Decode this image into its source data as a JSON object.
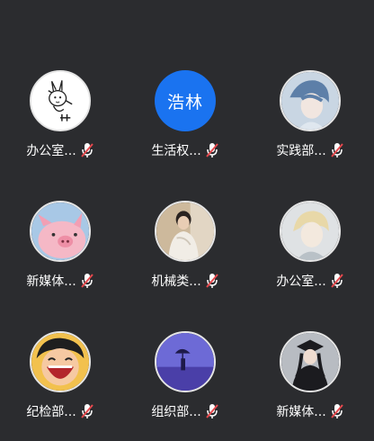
{
  "participants": [
    {
      "name": "办公室...",
      "avatar": "bunny-sticker-avatar",
      "mic": "mic-muted-icon"
    },
    {
      "name": "生活权...",
      "avatar": "text-avatar",
      "avatar_text": "浩林",
      "avatar_color": "#1a73f0",
      "mic": "mic-muted-icon"
    },
    {
      "name": "实践部...",
      "avatar": "anime-boy-avatar",
      "mic": "mic-muted-icon"
    },
    {
      "name": "新媒体...",
      "avatar": "pink-pig-avatar",
      "mic": "mic-muted-icon"
    },
    {
      "name": "机械类...",
      "avatar": "person-photo-avatar",
      "mic": "mic-muted-icon"
    },
    {
      "name": "办公室...",
      "avatar": "anime-blond-avatar",
      "mic": "mic-muted-icon"
    },
    {
      "name": "纪检部...",
      "avatar": "cartoon-laughing-avatar",
      "mic": "mic-muted-icon"
    },
    {
      "name": "组织部...",
      "avatar": "umbrella-scene-avatar",
      "mic": "mic-muted-icon"
    },
    {
      "name": "新媒体...",
      "avatar": "graduation-photo-avatar",
      "mic": "mic-muted-icon"
    }
  ],
  "colors": {
    "background": "#2b2c2f",
    "muted_slash": "#e5484d"
  }
}
